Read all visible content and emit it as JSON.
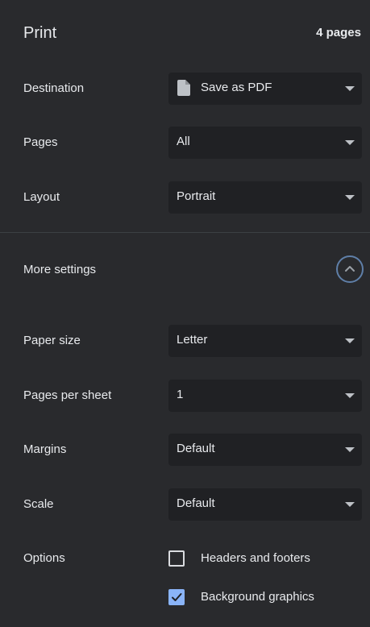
{
  "header": {
    "title": "Print",
    "page_count": "4 pages"
  },
  "settings": {
    "destination": {
      "label": "Destination",
      "value": "Save as PDF",
      "icon": "file-icon"
    },
    "pages": {
      "label": "Pages",
      "value": "All"
    },
    "layout": {
      "label": "Layout",
      "value": "Portrait"
    },
    "more_settings": {
      "label": "More settings",
      "icon": "chevron-up-icon",
      "expanded": true
    },
    "paper_size": {
      "label": "Paper size",
      "value": "Letter"
    },
    "pages_per_sheet": {
      "label": "Pages per sheet",
      "value": "1"
    },
    "margins": {
      "label": "Margins",
      "value": "Default"
    },
    "scale": {
      "label": "Scale",
      "value": "Default"
    },
    "options": {
      "label": "Options",
      "items": [
        {
          "label": "Headers and footers",
          "checked": false
        },
        {
          "label": "Background graphics",
          "checked": true
        }
      ]
    }
  },
  "colors": {
    "background": "#292a2d",
    "select_background": "#202124",
    "accent": "#8ab4f8",
    "text": "#e8eaed"
  }
}
